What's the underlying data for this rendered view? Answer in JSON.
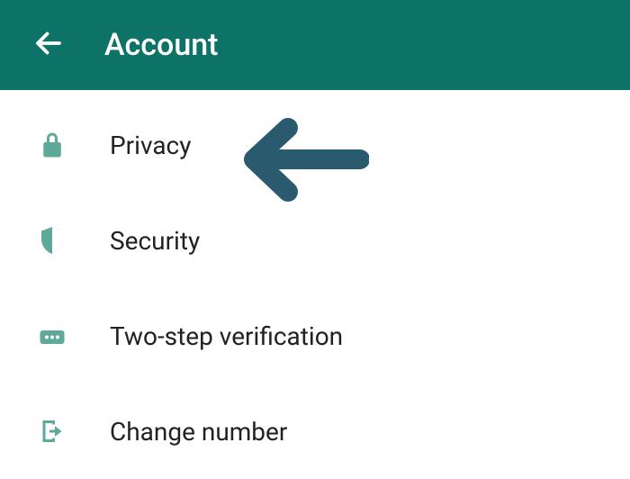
{
  "header": {
    "title": "Account"
  },
  "items": [
    {
      "label": "Privacy"
    },
    {
      "label": "Security"
    },
    {
      "label": "Two-step verification"
    },
    {
      "label": "Change number"
    }
  ],
  "icons": {
    "back": "back-arrow-icon",
    "privacy": "lock-icon",
    "security": "shield-icon",
    "twostep": "dots-icon",
    "change": "exit-icon"
  },
  "colors": {
    "header": "#0d7366",
    "icon": "#5fa99a",
    "annotation": "#2a5a6e"
  }
}
